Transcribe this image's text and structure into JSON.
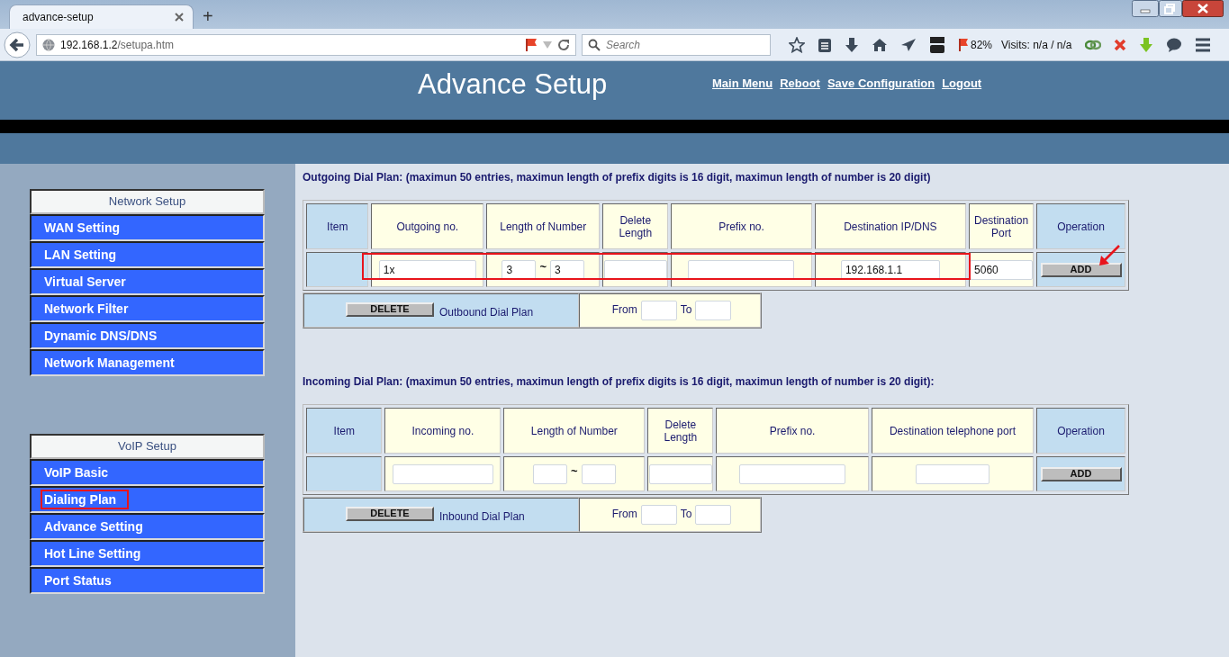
{
  "browser": {
    "tab_title": "advance-setup",
    "new_tab": "+",
    "url_host": "192.168.1.2",
    "url_path": "/setupa.htm",
    "search_placeholder": "Search",
    "zoom": "82%",
    "visits": "Visits: n/a / n/a"
  },
  "header": {
    "title": "Advance Setup",
    "links": [
      "Main Menu",
      "Reboot",
      "Save Configuration",
      "Logout"
    ]
  },
  "sidebar": {
    "groups": [
      {
        "title": "Network Setup",
        "items": [
          {
            "label": "WAN Setting",
            "highlighted": false
          },
          {
            "label": "LAN Setting",
            "highlighted": false
          },
          {
            "label": "Virtual Server",
            "highlighted": false
          },
          {
            "label": "Network Filter",
            "highlighted": false
          },
          {
            "label": "Dynamic DNS/DNS",
            "highlighted": false
          },
          {
            "label": "Network Management",
            "highlighted": false
          }
        ]
      },
      {
        "title": "VoIP Setup",
        "items": [
          {
            "label": "VoIP Basic",
            "highlighted": false
          },
          {
            "label": "Dialing Plan",
            "highlighted": true
          },
          {
            "label": "Advance Setting",
            "highlighted": false
          },
          {
            "label": "Hot Line Setting",
            "highlighted": false
          },
          {
            "label": "Port Status",
            "highlighted": false
          }
        ]
      }
    ]
  },
  "plans": [
    {
      "heading": "Outgoing Dial Plan: (maximun 50 entries, maximun length of prefix digits is 16 digit, maximun length of number is 20 digit)",
      "row_highlighted": true,
      "add_pointed": true,
      "columns": [
        "Item",
        "Outgoing no.",
        "Length of Number",
        "Delete Length",
        "Prefix no.",
        "Destination IP/DNS",
        "Destination Port",
        "Operation"
      ],
      "cells": [
        {
          "kind": "blank"
        },
        {
          "kind": "field",
          "value": "1x"
        },
        {
          "kind": "range",
          "from": "3",
          "separator": "~",
          "to": "3"
        },
        {
          "kind": "field"
        },
        {
          "kind": "field"
        },
        {
          "kind": "field",
          "value": "192.168.1.1"
        },
        {
          "kind": "field",
          "value": "5060"
        },
        {
          "kind": "button",
          "label": "ADD"
        }
      ],
      "delete_button": "DELETE",
      "delete_caption": "Outbound Dial Plan",
      "from_label": "From",
      "to_label": "To"
    },
    {
      "heading": "Incoming Dial Plan: (maximun 50 entries, maximun length of prefix digits is 16 digit, maximun length of number is 20 digit):",
      "row_highlighted": false,
      "add_pointed": false,
      "columns": [
        "Item",
        "Incoming no.",
        "Length of Number",
        "Delete Length",
        "Prefix no.",
        "Destination telephone port",
        "Operation"
      ],
      "cells": [
        {
          "kind": "blank"
        },
        {
          "kind": "field"
        },
        {
          "kind": "range",
          "separator": "~"
        },
        {
          "kind": "field"
        },
        {
          "kind": "field"
        },
        {
          "kind": "field"
        },
        {
          "kind": "button",
          "label": "ADD"
        }
      ],
      "delete_button": "DELETE",
      "delete_caption": "Inbound Dial Plan",
      "from_label": "From",
      "to_label": "To"
    }
  ]
}
